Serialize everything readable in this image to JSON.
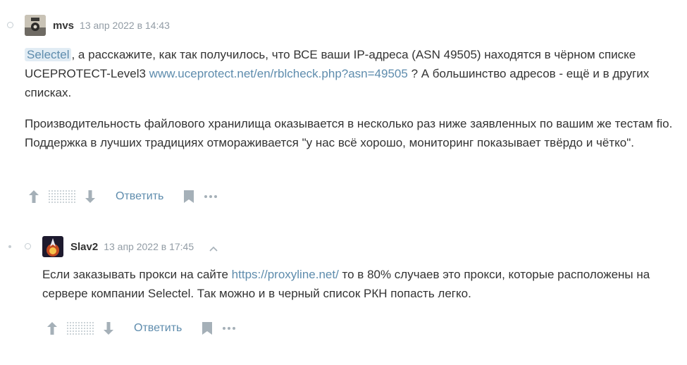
{
  "comments": [
    {
      "username": "mvs",
      "date": "13 апр 2022 в 14:43",
      "paragraphs": [
        {
          "mention": "Selectel",
          "text_a": ", а расскажите, как так получилось, что ВСЕ ваши IP-адреса (ASN 49505) находятся в чёрном списке UCEPROTECT-Level3 ",
          "link": "www.uceprotect.net/en/rblcheck.php?asn=49505",
          "text_b": " ? А большинство адресов - ещё и в других списках."
        },
        {
          "text": "Производительность файлового хранилища оказывается в несколько раз ниже заявленных по вашим же тестам fio. Поддержка в лучших традициях отмораживается \"у нас всё хорошо, мониторинг показывает твёрдо и чётко\"."
        }
      ],
      "reply_label": "Ответить"
    },
    {
      "username": "Slav2",
      "date": "13 апр 2022 в 17:45",
      "paragraphs": [
        {
          "text_a": "Если заказывать прокси на сайте ",
          "link": "https://proxyline.net/",
          "text_b": " то в 80% случаев это прокси, которые расположены на сервере компании Selectel. Так можно и в черный список РКН попасть легко."
        }
      ],
      "reply_label": "Ответить"
    }
  ],
  "icons": {
    "upvote": "arrow-up-icon",
    "downvote": "arrow-down-icon",
    "bookmark": "bookmark-icon",
    "more": "more-dots-icon",
    "parent": "chevron-up-icon"
  },
  "colors": {
    "text": "#333333",
    "meta": "#929ca5",
    "link": "#5e8cad",
    "mention_bg": "#e1ecf4",
    "icon": "#a5b0b8"
  }
}
